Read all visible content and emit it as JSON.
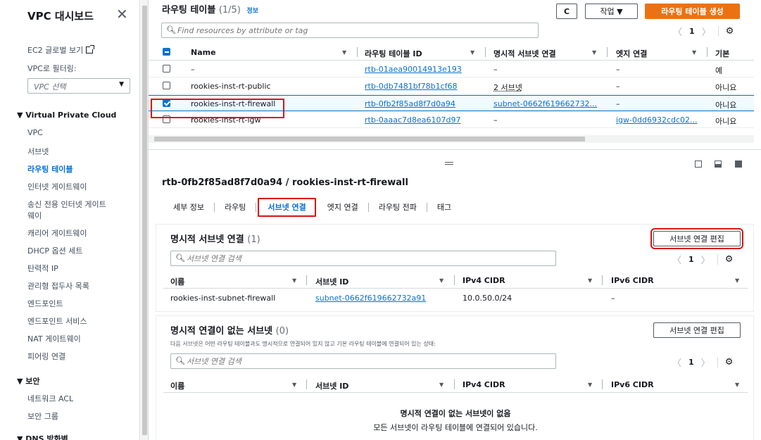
{
  "sidebar": {
    "title": "VPC 대시보드",
    "close_glyph": "✕",
    "ec2_global": "EC2 글로벌 보기",
    "filter_label": "VPC로 필터링:",
    "filter_placeholder": "VPC 선택",
    "section_vpc": "▼ Virtual Private Cloud",
    "items": [
      {
        "label": "VPC"
      },
      {
        "label": "서브넷"
      },
      {
        "label": "라우팅 테이블",
        "active": true
      },
      {
        "label": "인터넷 게이트웨이"
      },
      {
        "label": "송신 전용 인터넷 게이트"
      },
      {
        "label": "웨이"
      },
      {
        "label": "캐리어 게이트웨이"
      },
      {
        "label": "DHCP 옵션 세트"
      },
      {
        "label": "탄력적 IP"
      },
      {
        "label": "관리형 접두사 목록"
      },
      {
        "label": "엔드포인트"
      },
      {
        "label": "엔드포인트 서비스"
      },
      {
        "label": "NAT 게이트웨이"
      },
      {
        "label": "피어링 연결"
      }
    ],
    "section_security": "▼ 보안",
    "security_items": [
      {
        "label": "네트워크 ACL"
      },
      {
        "label": "보안 그룹"
      }
    ],
    "section_dns": "▼ DNS 방화벽"
  },
  "route_tables": {
    "title": "라우팅 테이블",
    "count": "(1/5)",
    "info": "정보",
    "refresh_glyph": "C",
    "actions_label": "작업 ▼",
    "create_label": "라우팅 테이블 생성",
    "search_placeholder": "Find resources by attribute or tag",
    "pager": {
      "prev": "〈",
      "page": "1",
      "next": "〉",
      "gear": "⚙"
    },
    "columns": [
      "Name",
      "라우팅 테이블 ID",
      "명시적 서브넷 연결",
      "엣지 연결",
      "기본"
    ],
    "sort_glyph": "▼",
    "rows": [
      {
        "name": "–",
        "id": "rtb-01aea90014913e193",
        "subnets": "–",
        "edge": "–",
        "main": "예",
        "checked": false
      },
      {
        "name": "rookies-inst-rt-public",
        "id": "rtb-0db7481bf78b1cf68",
        "subnets": "2 서브넷",
        "edge": "–",
        "main": "아니요",
        "checked": false
      },
      {
        "name": "rookies-inst-rt-firewall",
        "id": "rtb-0fb2f85ad8f7d0a94",
        "subnets": "subnet-0662f619662732...",
        "edge": "–",
        "main": "아니요",
        "checked": true
      },
      {
        "name": "rookies-inst-rt-igw",
        "id": "rtb-0aaac7d8ea6107d97",
        "subnets": "–",
        "edge": "igw-0dd6932cdc02...",
        "main": "아니요",
        "checked": false
      }
    ]
  },
  "detail": {
    "title": "rtb-0fb2f85ad8f7d0a94 / rookies-inst-rt-firewall",
    "tabs": [
      "세부 정보",
      "라우팅",
      "서브넷 연결",
      "엣지 연결",
      "라우팅 전파",
      "태그"
    ],
    "active_tab": 2
  },
  "explicit": {
    "title": "명시적 서브넷 연결",
    "count": "(1)",
    "edit_label": "서브넷 연결 편집",
    "search_placeholder": "서브넷 연결 검색",
    "columns": [
      "이름",
      "서브넷 ID",
      "IPv4 CIDR",
      "IPv6 CIDR"
    ],
    "rows": [
      {
        "name": "rookies-inst-subnet-firewall",
        "subnet_id": "subnet-0662f619662732a91",
        "ipv4": "10.0.50.0/24",
        "ipv6": "–"
      }
    ]
  },
  "unassociated": {
    "title": "명시적 연결이 없는 서브넷",
    "count": "(0)",
    "edit_label": "서브넷 연결 편집",
    "desc": "다음 서브넷은 어떤 라우팅 테이블과도 명시적으로 연결되어 있지 않고 기본 라우팅 테이블에 연결되어 있는 상태:",
    "search_placeholder": "서브넷 연결 검색",
    "columns": [
      "이름",
      "서브넷 ID",
      "IPv4 CIDR",
      "IPv6 CIDR"
    ],
    "empty_title": "명시적 연결이 없는 서브넷이 없음",
    "empty_desc": "모든 서브넷이 라우팅 테이블에 연결되어 있습니다."
  },
  "colors": {
    "accent": "#0972d3",
    "primary": "#ec7211",
    "highlight": "#d91515"
  }
}
